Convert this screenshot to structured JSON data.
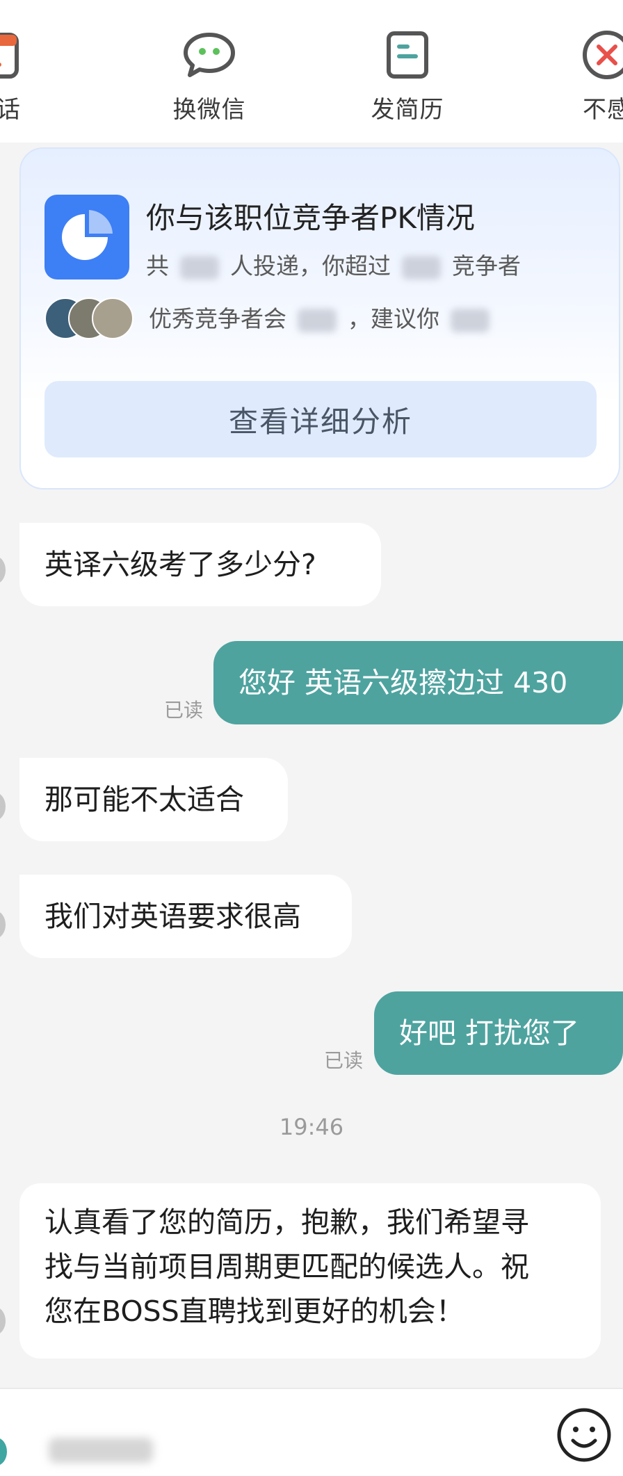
{
  "toolbar": {
    "items": [
      {
        "label": "电话",
        "icon": "phone-icon"
      },
      {
        "label": "换微信",
        "icon": "wechat-icon"
      },
      {
        "label": "发简历",
        "icon": "resume-icon"
      },
      {
        "label": "不感",
        "icon": "not-interested-icon"
      }
    ]
  },
  "pk_card": {
    "title": "你与该职位竞争者PK情况",
    "line1_prefix": "共",
    "line1_middle": "人投递，你超过",
    "line1_suffix": "竞争者",
    "line2_prefix": "优秀竞争者会",
    "line2_middle": "，建议你",
    "button_label": "查看详细分析"
  },
  "messages": [
    {
      "side": "left",
      "text": "英译六级考了多少分?"
    },
    {
      "side": "right",
      "text": "您好 英语六级擦边过 430",
      "status": "已读"
    },
    {
      "side": "left",
      "text": "那可能不太适合"
    },
    {
      "side": "left",
      "text": "我们对英语要求很高"
    },
    {
      "side": "right",
      "text": "好吧 打扰您了",
      "status": "已读"
    },
    {
      "side": "left",
      "lines": [
        "认真看了您的简历，抱歉，我们希望寻",
        "找与当前项目周期更匹配的候选人。祝",
        "您在BOSS直聘找到更好的机会！"
      ]
    }
  ],
  "timestamp": "19:46",
  "colors": {
    "accent_teal": "#4ea39f",
    "pk_blue": "#3d7ff5",
    "toolbar_orange": "#e8673c",
    "icon_gray": "#555555"
  }
}
